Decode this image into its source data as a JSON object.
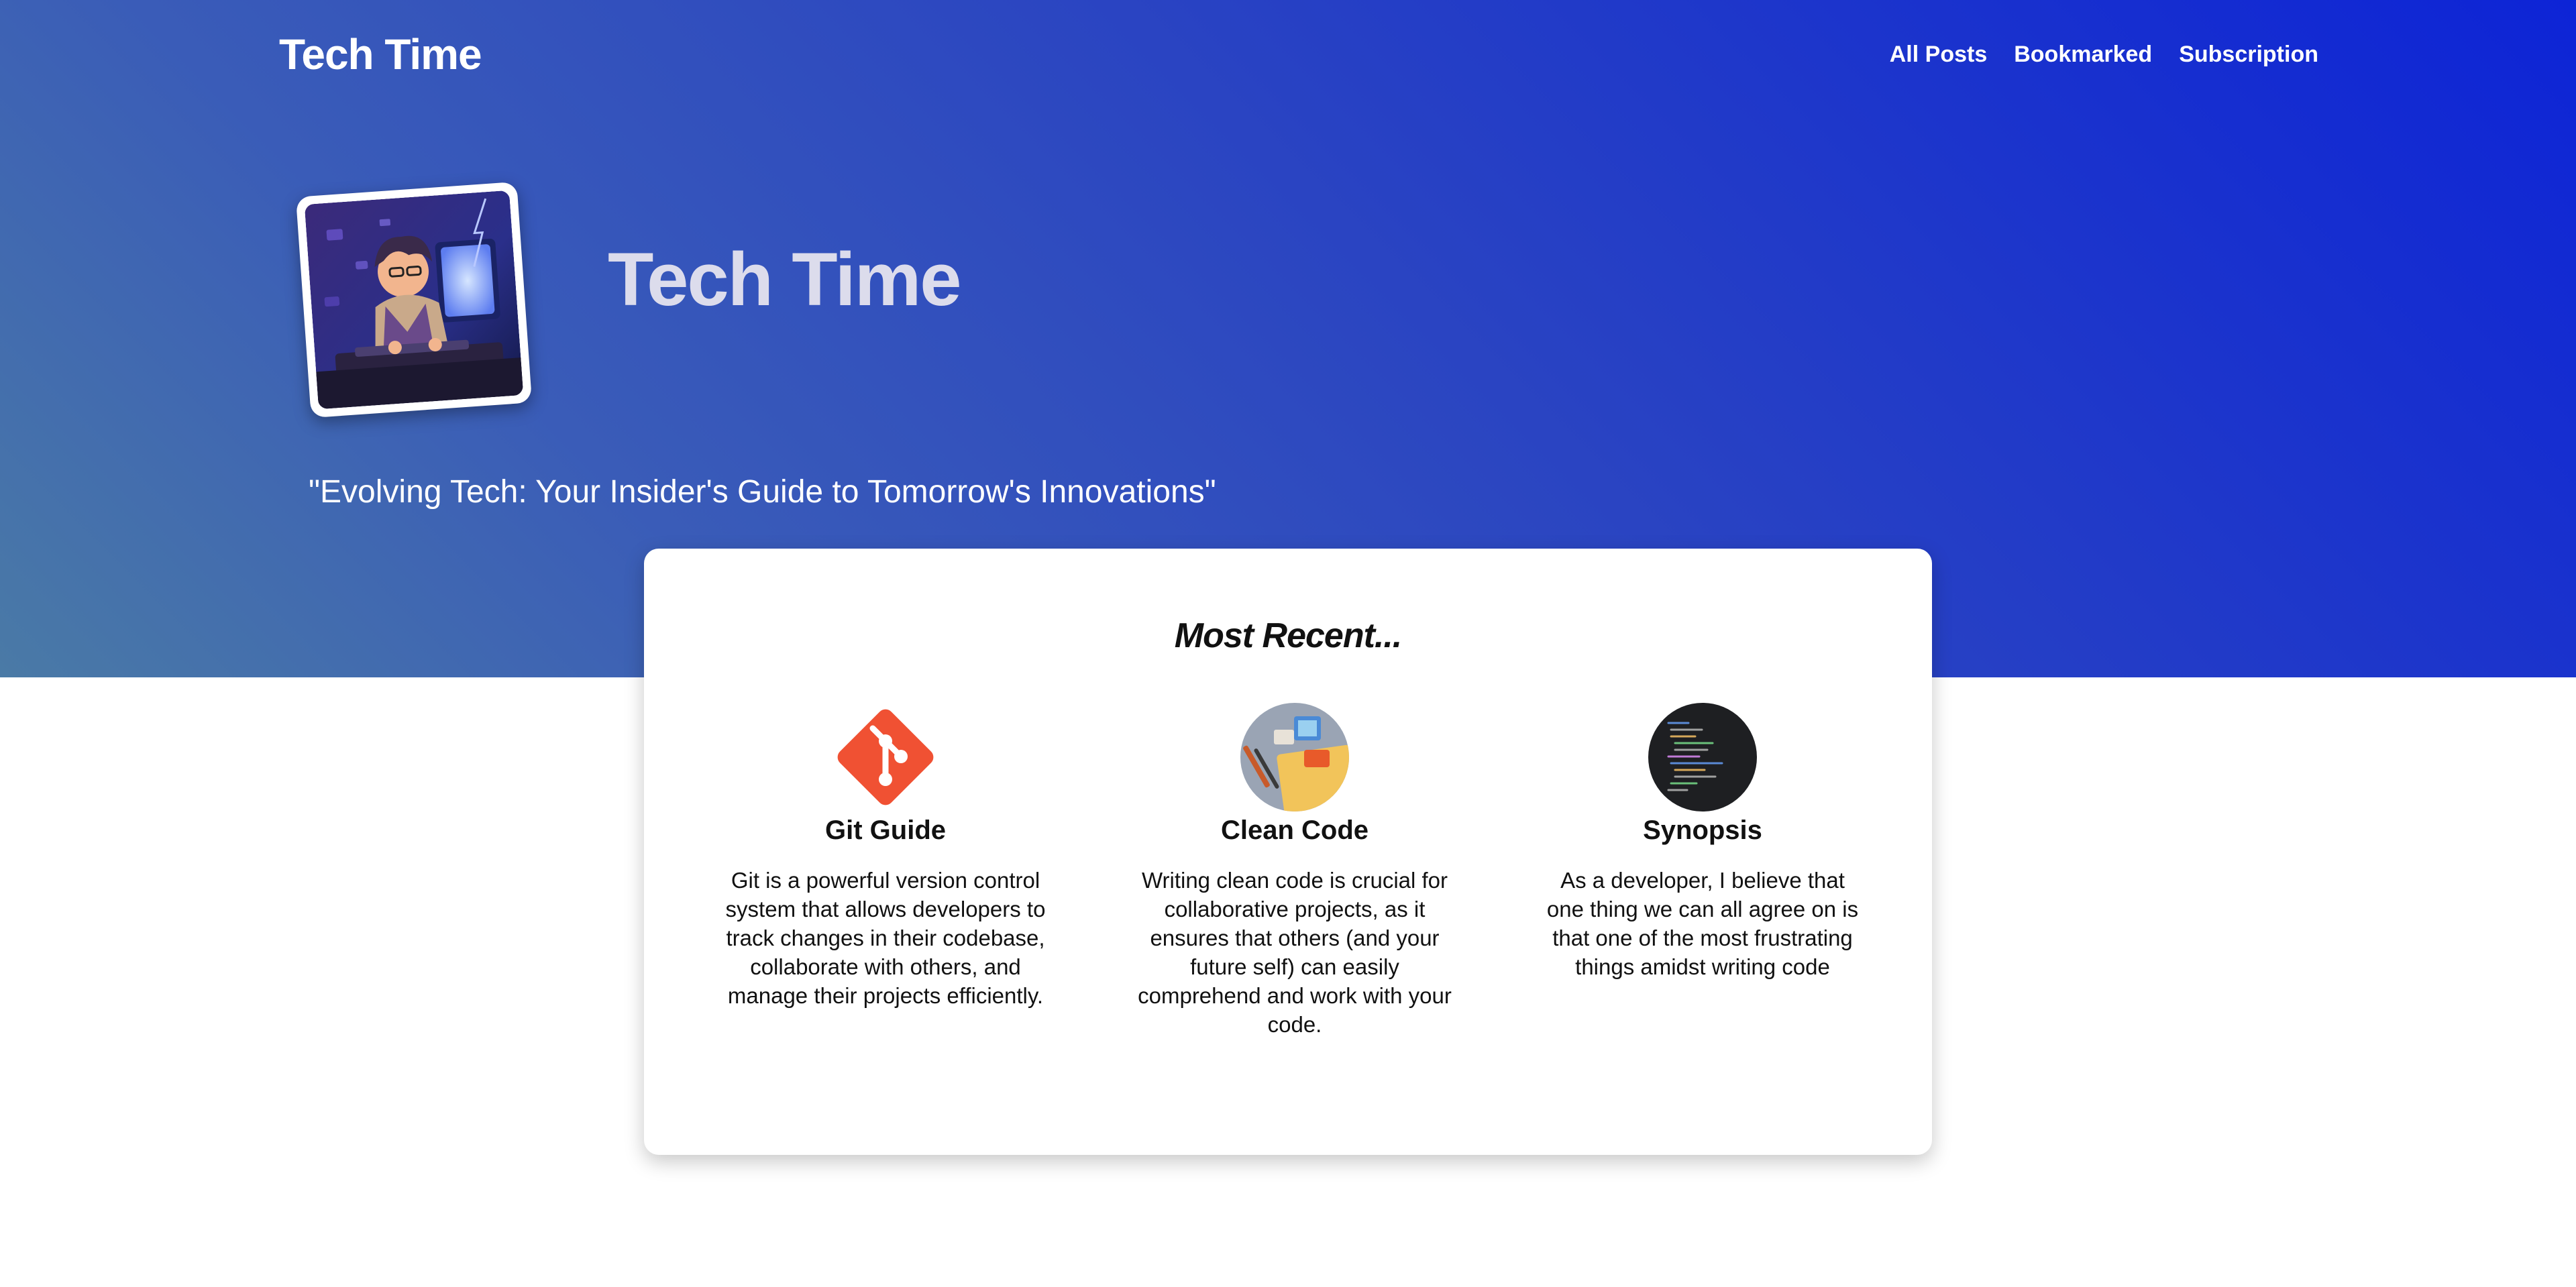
{
  "header": {
    "brand": "Tech Time",
    "nav": [
      "All Posts",
      "Bookmarked",
      "Subscription"
    ]
  },
  "hero": {
    "title": "Tech Time",
    "tagline": "\"Evolving Tech: Your Insider's Guide to Tomorrow's Innovations\""
  },
  "recent": {
    "heading": "Most Recent...",
    "posts": [
      {
        "title": "Git Guide",
        "icon": "git-logo-icon",
        "excerpt": "Git is a powerful version control system that allows developers to track changes in their codebase, collaborate with others, and manage their projects efficiently."
      },
      {
        "title": "Clean Code",
        "icon": "clean-code-thumbnail",
        "excerpt": "Writing clean code is crucial for collaborative projects, as it ensures that others (and your future self) can easily comprehend and work with your code."
      },
      {
        "title": "Synopsis",
        "icon": "code-screen-thumbnail",
        "excerpt": "As a developer, I believe that one thing we can all agree on is that one of the most frustrating things amidst writing code"
      }
    ]
  },
  "colors": {
    "hero_gradient_start": "#0d24d6",
    "hero_gradient_end": "#4a7aa6",
    "git_orange": "#f05133"
  }
}
